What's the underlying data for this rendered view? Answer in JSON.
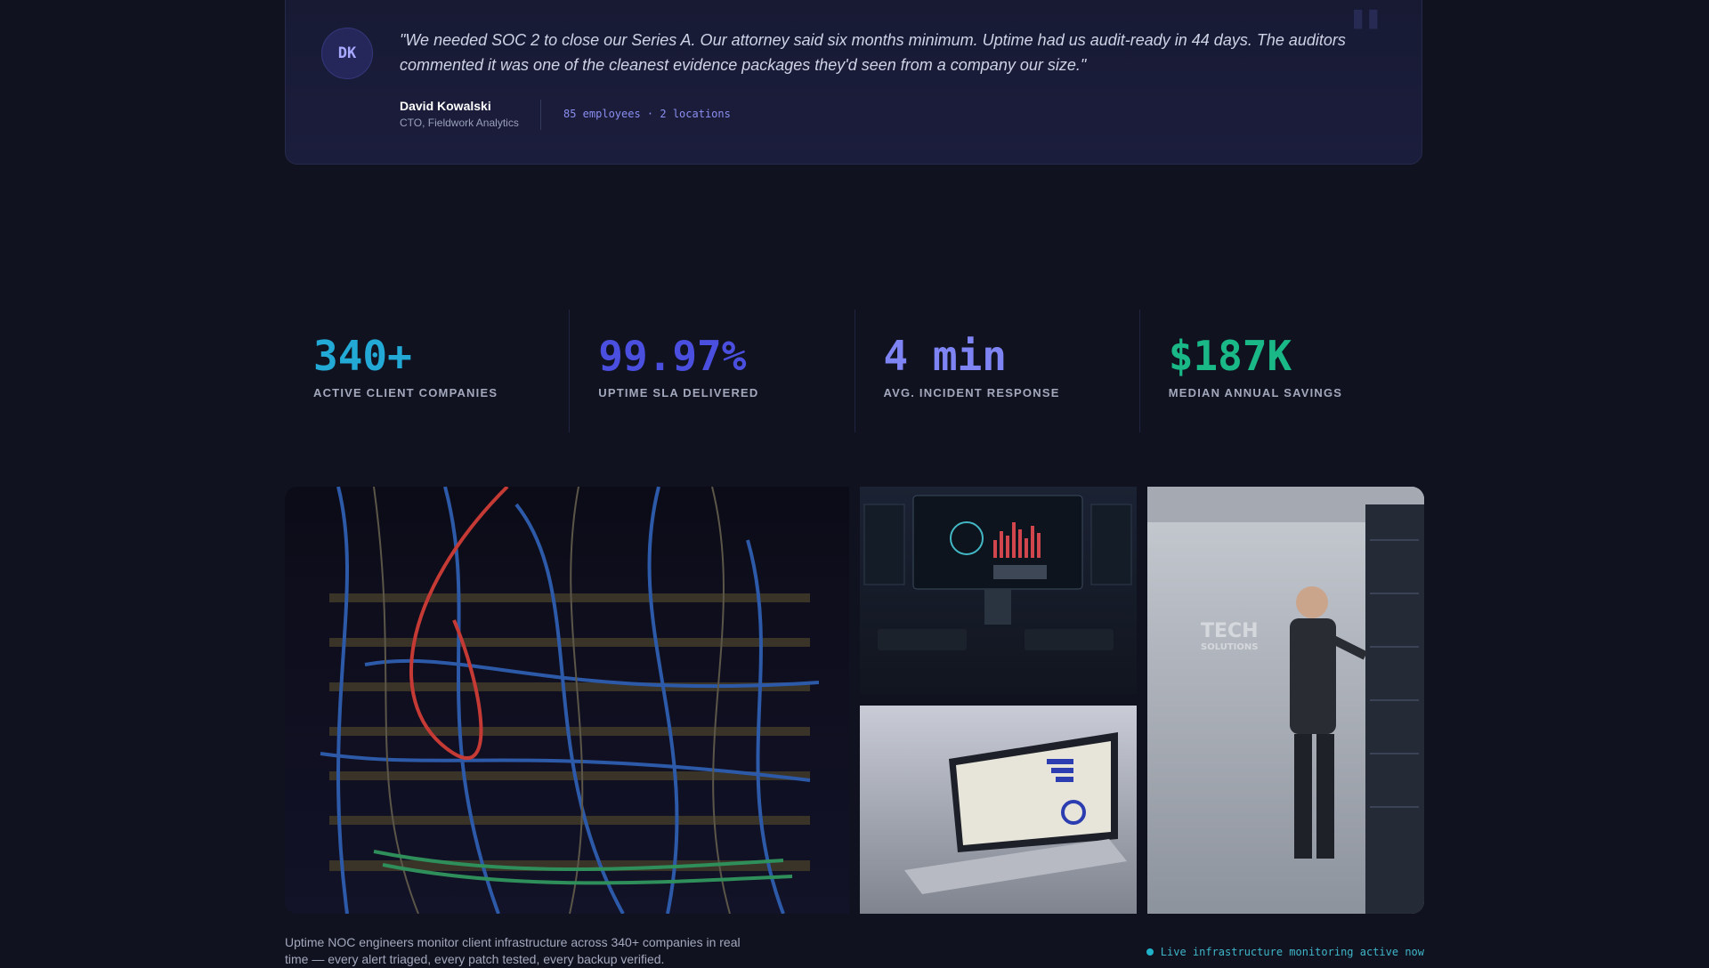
{
  "testimonial": {
    "initials": "DK",
    "quote": "\"We needed SOC 2 to close our Series A. Our attorney said six months minimum. Uptime had us audit-ready in 44 days. The auditors commented it was one of the cleanest evidence packages they'd seen from a company our size.\"",
    "author_name": "David Kowalski",
    "author_role": "CTO, Fieldwork Analytics",
    "meta": "85 employees · 2 locations"
  },
  "stats": [
    {
      "value": "340+",
      "label": "ACTIVE CLIENT COMPANIES",
      "color": "#22a9d6"
    },
    {
      "value": "99.97%",
      "label": "UPTIME SLA DELIVERED",
      "color": "#4b4fe0"
    },
    {
      "value": "4 min",
      "label": "AVG. INCIDENT RESPONSE",
      "color": "#7f84f5"
    },
    {
      "value": "$187K",
      "label": "MEDIAN ANNUAL SAVINGS",
      "color": "#19b886"
    }
  ],
  "gallery": {
    "logo_text": "TECH",
    "logo_sub": "SOLUTIONS"
  },
  "caption": "Uptime NOC engineers monitor client infrastructure across 340+ companies in real time — every alert triaged, every patch tested, every backup verified.",
  "live_status": "Live infrastructure monitoring active now"
}
